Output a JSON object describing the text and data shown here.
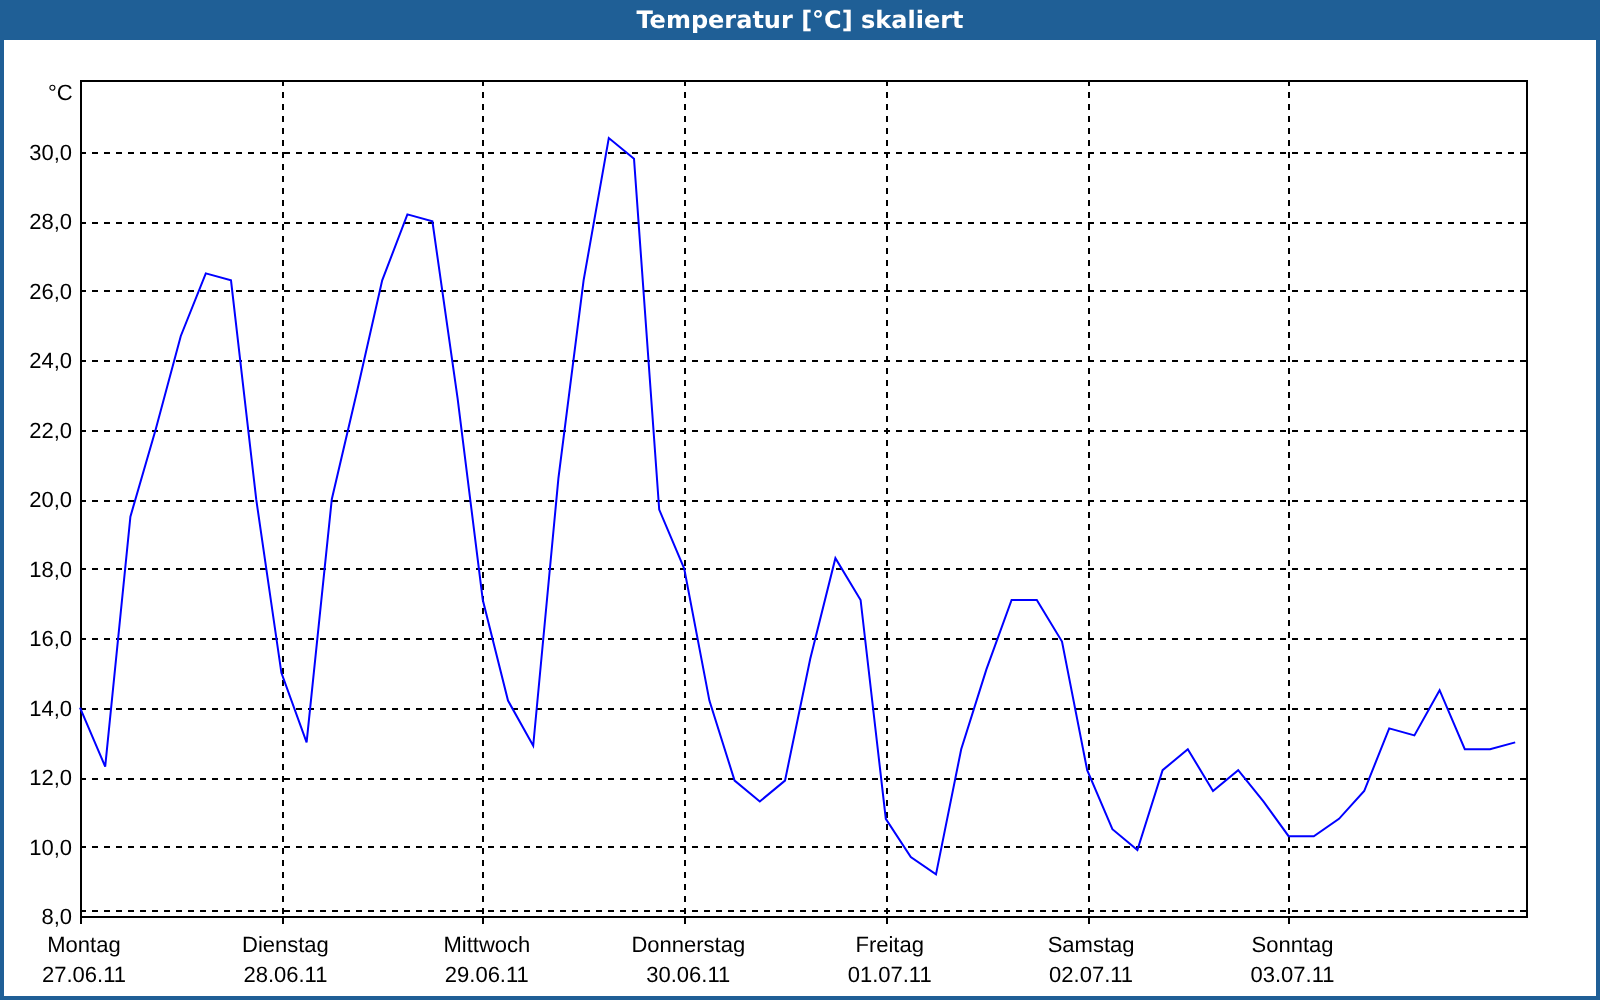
{
  "window": {
    "title": "Temperatur [°C] skaliert"
  },
  "chart": {
    "chart_data": {
      "type": "line",
      "grid": true,
      "ylabel": "°C",
      "categories": [
        "Montag 27.06.11",
        null,
        null,
        null,
        null,
        null,
        null,
        null,
        "Dienstag 28.06.11",
        null,
        null,
        null,
        null,
        null,
        null,
        null,
        "Mittwoch 29.06.11",
        null,
        null,
        null,
        null,
        null,
        null,
        null,
        "Donnerstag 30.06.11",
        null,
        null,
        null,
        null,
        null,
        null,
        null,
        "Freitag 01.07.11",
        null,
        null,
        null,
        null,
        null,
        null,
        null,
        "Samstag 02.07.11",
        null,
        null,
        null,
        null,
        null,
        null,
        null,
        "Sonntag 03.07.11",
        null,
        null,
        null,
        null,
        null,
        null,
        null,
        null,
        null
      ],
      "values": [
        14.0,
        12.3,
        19.5,
        22.0,
        24.7,
        26.5,
        26.3,
        20.0,
        15.0,
        13.0,
        20.0,
        23.1,
        26.3,
        28.2,
        28.0,
        22.9,
        17.1,
        14.2,
        12.9,
        20.6,
        26.3,
        30.4,
        29.8,
        19.7,
        18.0,
        14.2,
        11.9,
        11.3,
        11.9,
        15.4,
        18.3,
        17.1,
        10.8,
        9.7,
        9.2,
        12.8,
        15.1,
        17.1,
        17.1,
        15.9,
        12.2,
        10.5,
        9.9,
        12.2,
        12.8,
        11.6,
        12.2,
        11.3,
        10.3,
        10.3,
        10.8,
        11.6,
        13.4,
        13.2,
        14.5,
        12.8,
        12.8,
        13.0
      ],
      "ylim": [
        8,
        32.07
      ],
      "yticks": [
        {
          "value": 8,
          "label": "8,0"
        },
        {
          "value": 10,
          "label": "10,0"
        },
        {
          "value": 12,
          "label": "12,0"
        },
        {
          "value": 14,
          "label": "14,0"
        },
        {
          "value": 16,
          "label": "16,0"
        },
        {
          "value": 18,
          "label": "18,0"
        },
        {
          "value": 20,
          "label": "20,0"
        },
        {
          "value": 22,
          "label": "22,0"
        },
        {
          "value": 24,
          "label": "24,0"
        },
        {
          "value": 26,
          "label": "26,0"
        },
        {
          "value": 28,
          "label": "28,0"
        },
        {
          "value": 30,
          "label": "30,0"
        }
      ]
    }
  }
}
